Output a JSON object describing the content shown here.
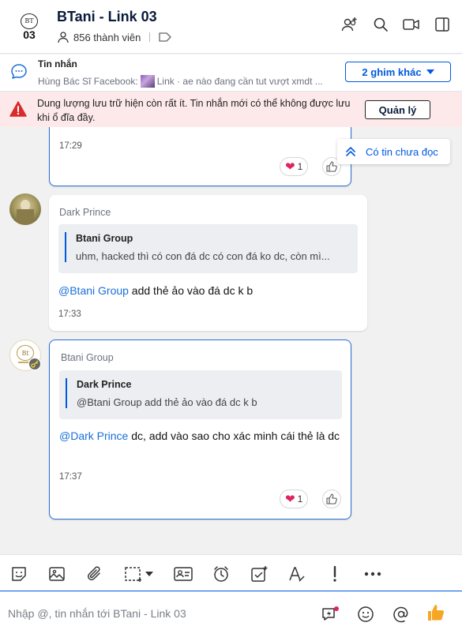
{
  "header": {
    "title": "BTani - Link 03",
    "members": "856 thành viên",
    "avatar_number": "03",
    "avatar_mono": "BT"
  },
  "pinned": {
    "title": "Tin nhắn",
    "sender": "Hùng Bác Sĩ Facebook:",
    "text": "Link · ae nào đang cần tut vượt xmdt ...",
    "more_label": "2 ghim khác"
  },
  "warning": {
    "text": "Dung lượng lưu trữ hiện còn rất ít. Tin nhắn mới có thể không được lưu khi ổ đĩa đầy.",
    "manage_label": "Quản lý"
  },
  "unread_label": "Có tin chưa đọc",
  "messages": [
    {
      "time": "17:29",
      "reaction_count": "1"
    },
    {
      "sender": "Dark Prince",
      "quote_name": "Btani Group",
      "quote_text": "uhm, hacked thì có con đá dc có con đá ko dc, còn mì...",
      "mention": "@Btani Group",
      "text": " add thẻ ảo vào đá dc k b",
      "time": "17:33"
    },
    {
      "sender": "Btani Group",
      "quote_name": "Dark Prince",
      "quote_text": "@Btani Group add thẻ ảo vào đá dc k b",
      "mention": "@Dark Prince",
      "text": " dc, add vào sao cho xác minh cái thẻ là dc",
      "time": "17:37",
      "reaction_count": "1"
    }
  ],
  "composer": {
    "placeholder": "Nhập @, tin nhắn tới BTani - Link 03"
  },
  "colors": {
    "accent": "#005ae0",
    "warning_bg": "#fde9e9",
    "warning_icon": "#d92b2b",
    "like": "#f5a623"
  }
}
